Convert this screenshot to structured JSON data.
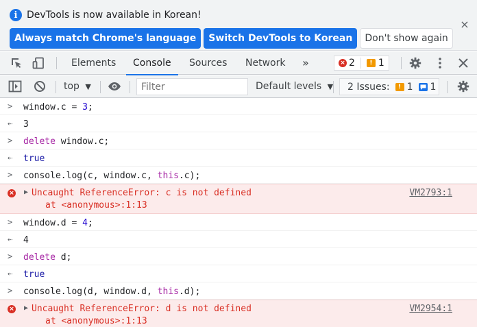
{
  "infobar": {
    "message": "DevTools is now available in Korean!",
    "btn_match": "Always match Chrome's language",
    "btn_switch": "Switch DevTools to Korean",
    "btn_dont_show": "Don't show again",
    "close_glyph": "×"
  },
  "tabs": {
    "elements": "Elements",
    "console": "Console",
    "sources": "Sources",
    "network": "Network",
    "more": "»",
    "error_count": "2",
    "warning_count": "1"
  },
  "console_toolbar": {
    "context": "top",
    "filter_placeholder": "Filter",
    "levels": "Default levels",
    "issues_label": "2 Issues:",
    "issues_warn": "1",
    "issues_info": "1"
  },
  "rows": [
    {
      "type": "input",
      "pre": "window.c = ",
      "num": "3",
      "post": ";"
    },
    {
      "type": "output",
      "value": "3"
    },
    {
      "type": "input",
      "kw": "delete",
      "rest": " window.c;"
    },
    {
      "type": "output",
      "value": "true"
    },
    {
      "type": "input",
      "pre": "console.log(c, window.c, ",
      "kw": "this",
      "post": ".c);"
    },
    {
      "type": "error",
      "line1": "Uncaught ReferenceError: c is not defined",
      "line2": "at <anonymous>:1:13",
      "source": "VM2793:1"
    },
    {
      "type": "input",
      "pre": "window.d = ",
      "num": "4",
      "post": ";"
    },
    {
      "type": "output",
      "value": "4"
    },
    {
      "type": "input",
      "kw": "delete",
      "rest": " d;"
    },
    {
      "type": "output",
      "value": "true"
    },
    {
      "type": "input",
      "pre": "console.log(d, window.d, ",
      "kw": "this",
      "post": ".d);"
    },
    {
      "type": "error",
      "line1": "Uncaught ReferenceError: d is not defined",
      "line2": "at <anonymous>:1:13",
      "source": "VM2954:1"
    }
  ],
  "colors": {
    "accent": "#1a73e8",
    "error": "#d93025",
    "warning": "#f29900",
    "keyword": "#a626a4"
  }
}
